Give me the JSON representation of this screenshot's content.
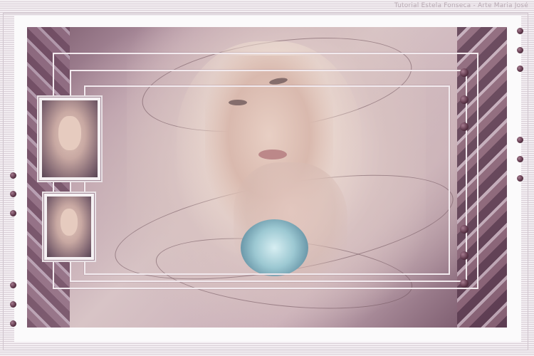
{
  "watermark": {
    "text": "Tutorial Estela Fonseca - Arte Maria José"
  },
  "palette": {
    "mauve_dark": "#5b3447",
    "mauve": "#8e6a80",
    "skin": "#e8cfc4",
    "flower_blue": "#9cc8d2",
    "frame_white": "#f2eaee"
  },
  "main_image": {
    "subject": "woman-portrait"
  },
  "thumbnails": [
    {
      "subject": "woman-portrait-thumbnail-1"
    },
    {
      "subject": "woman-portrait-thumbnail-2"
    }
  ]
}
